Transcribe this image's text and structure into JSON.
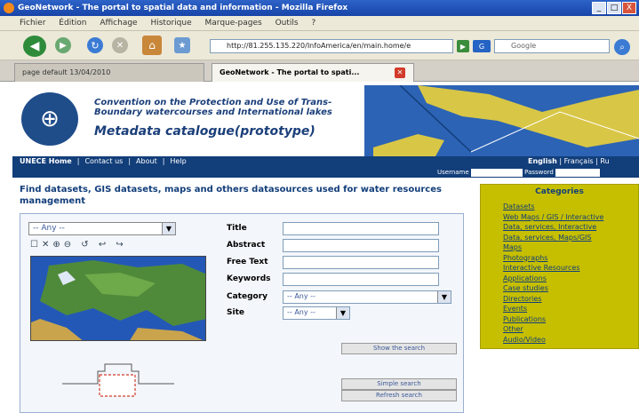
{
  "window": {
    "title": "GeoNetwork - The portal to spatial data and information - Mozilla Firefox",
    "minimize": "_",
    "maximize": "□",
    "close": "X"
  },
  "menu": [
    "Fichier",
    "Édition",
    "Affichage",
    "Historique",
    "Marque-pages",
    "Outils",
    "?"
  ],
  "toolbar": {
    "url": "http://81.255.135.220/InfoAmerica/en/main.home/e",
    "search_placeholder": "Google"
  },
  "tabs": [
    {
      "label": "page default 13/04/2010"
    },
    {
      "label": "GeoNetwork - The portal to spati..."
    }
  ],
  "header": {
    "convention": "Convention on the Protection and Use of Trans-Boundary watercourses and International lakes",
    "title": "Metadata catalogue(prototype)"
  },
  "nav": {
    "links": [
      "UNECE Home",
      "|",
      "Contact us",
      "|",
      "About",
      "|",
      "Help"
    ],
    "languages": [
      "English",
      "|",
      "Français",
      "|",
      "Ru"
    ],
    "username_label": "Username",
    "password_label": "Password"
  },
  "main": {
    "intro": "Find datasets, GIS datasets, maps and others datasources used for water resources management",
    "layer_select": "-- Any --",
    "map_tools": "☐✕⊕⊖ ↺ ↩ ↪",
    "form": {
      "title_label": "Title",
      "abstract_label": "Abstract",
      "freetext_label": "Free Text",
      "keywords_label": "Keywords",
      "category_label": "Category",
      "category_value": "-- Any --",
      "site_label": "Site",
      "site_value": "-- Any --"
    },
    "buttons": {
      "search": "Show the search",
      "simple": "Simple search",
      "reset": "Refresh search"
    }
  },
  "categories": {
    "title": "Categories",
    "items": [
      "Datasets",
      "Web Maps / GIS / Interactive",
      "Data, services, Interactive",
      "Data, services, Maps/GIS",
      "Maps",
      "Photographs",
      "Interactive Resources",
      "Applications",
      "Case studies",
      "Directories",
      "Events",
      "Publications",
      "Other",
      "Audio/Video"
    ]
  },
  "colors": {
    "titlebar": "#1744a8",
    "nav_strip": "#123e7a",
    "heading_blue": "#123e7a",
    "category_panel": "#c6bf00"
  }
}
